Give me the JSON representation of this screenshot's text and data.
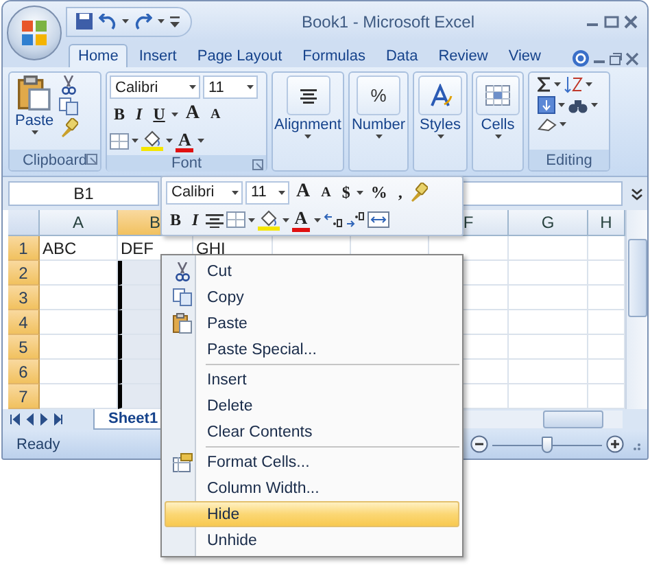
{
  "window": {
    "title": "Book1 - Microsoft Excel"
  },
  "ribbon_tabs": [
    {
      "label": "Home",
      "selected": true
    },
    {
      "label": "Insert",
      "selected": false
    },
    {
      "label": "Page Layout",
      "selected": false
    },
    {
      "label": "Formulas",
      "selected": false
    },
    {
      "label": "Data",
      "selected": false
    },
    {
      "label": "Review",
      "selected": false
    },
    {
      "label": "View",
      "selected": false
    }
  ],
  "clipboard_group": {
    "label": "Clipboard",
    "paste_label": "Paste"
  },
  "font_group": {
    "label": "Font",
    "font": "Calibri",
    "size": "11",
    "style_buttons": [
      "B",
      "I",
      "U"
    ],
    "grow_glyph": "A",
    "shrink_glyph": "A",
    "color_glyph": "A"
  },
  "large_groups": [
    {
      "kind": "alignment",
      "label": "Alignment"
    },
    {
      "kind": "number",
      "label": "Number",
      "glyph": "%"
    },
    {
      "kind": "styles",
      "label": "Styles"
    },
    {
      "kind": "cells",
      "label": "Cells"
    }
  ],
  "editing_group": {
    "label": "Editing"
  },
  "name_box": "B1",
  "mini_toolbar": {
    "font": "Calibri",
    "size": "11",
    "grow_glyph": "A",
    "shrink_glyph": "A",
    "currency_glyph": "$",
    "percent_glyph": "%",
    "comma_glyph": ",",
    "bold_glyph": "B",
    "italic_glyph": "I",
    "color_glyph": "A"
  },
  "columns": [
    {
      "label": "A",
      "selected": false
    },
    {
      "label": "B",
      "selected": true
    },
    {},
    {},
    {},
    {
      "label": "F",
      "selected": false
    },
    {
      "label": "G",
      "selected": false
    },
    {
      "label": "H",
      "selected": false
    }
  ],
  "rows": [
    {
      "header": "1",
      "cells": [
        "ABC",
        "DEF",
        "GHI"
      ]
    },
    {
      "header": "2"
    },
    {
      "header": "3"
    },
    {
      "header": "4"
    },
    {
      "header": "5"
    },
    {
      "header": "6"
    },
    {
      "header": "7"
    }
  ],
  "sheet_tabs": [
    {
      "label": "Sheet1",
      "selected": true
    }
  ],
  "status_bar": {
    "text": "Ready",
    "zoom_slider": {
      "level": 0.5
    }
  },
  "context_menu": [
    {
      "kind": "cut",
      "label": "Cut",
      "selected": false,
      "separator_before": false
    },
    {
      "kind": "copy",
      "label": "Copy",
      "selected": false,
      "separator_before": false
    },
    {
      "kind": "paste",
      "label": "Paste",
      "selected": false,
      "separator_before": false
    },
    {
      "kind": "plain",
      "label": "Paste Special...",
      "selected": false,
      "separator_before": false
    },
    {
      "kind": "plain",
      "label": "Insert",
      "selected": false,
      "separator_before": true
    },
    {
      "kind": "plain",
      "label": "Delete",
      "selected": false,
      "separator_before": false
    },
    {
      "kind": "plain",
      "label": "Clear Contents",
      "selected": false,
      "separator_before": false
    },
    {
      "kind": "format",
      "label": "Format Cells...",
      "selected": false,
      "separator_before": true
    },
    {
      "kind": "plain",
      "label": "Column Width...",
      "selected": false,
      "separator_before": false
    },
    {
      "kind": "plain",
      "label": "Hide",
      "selected": true,
      "separator_before": false
    },
    {
      "kind": "plain",
      "label": "Unhide",
      "selected": false,
      "separator_before": false
    }
  ]
}
